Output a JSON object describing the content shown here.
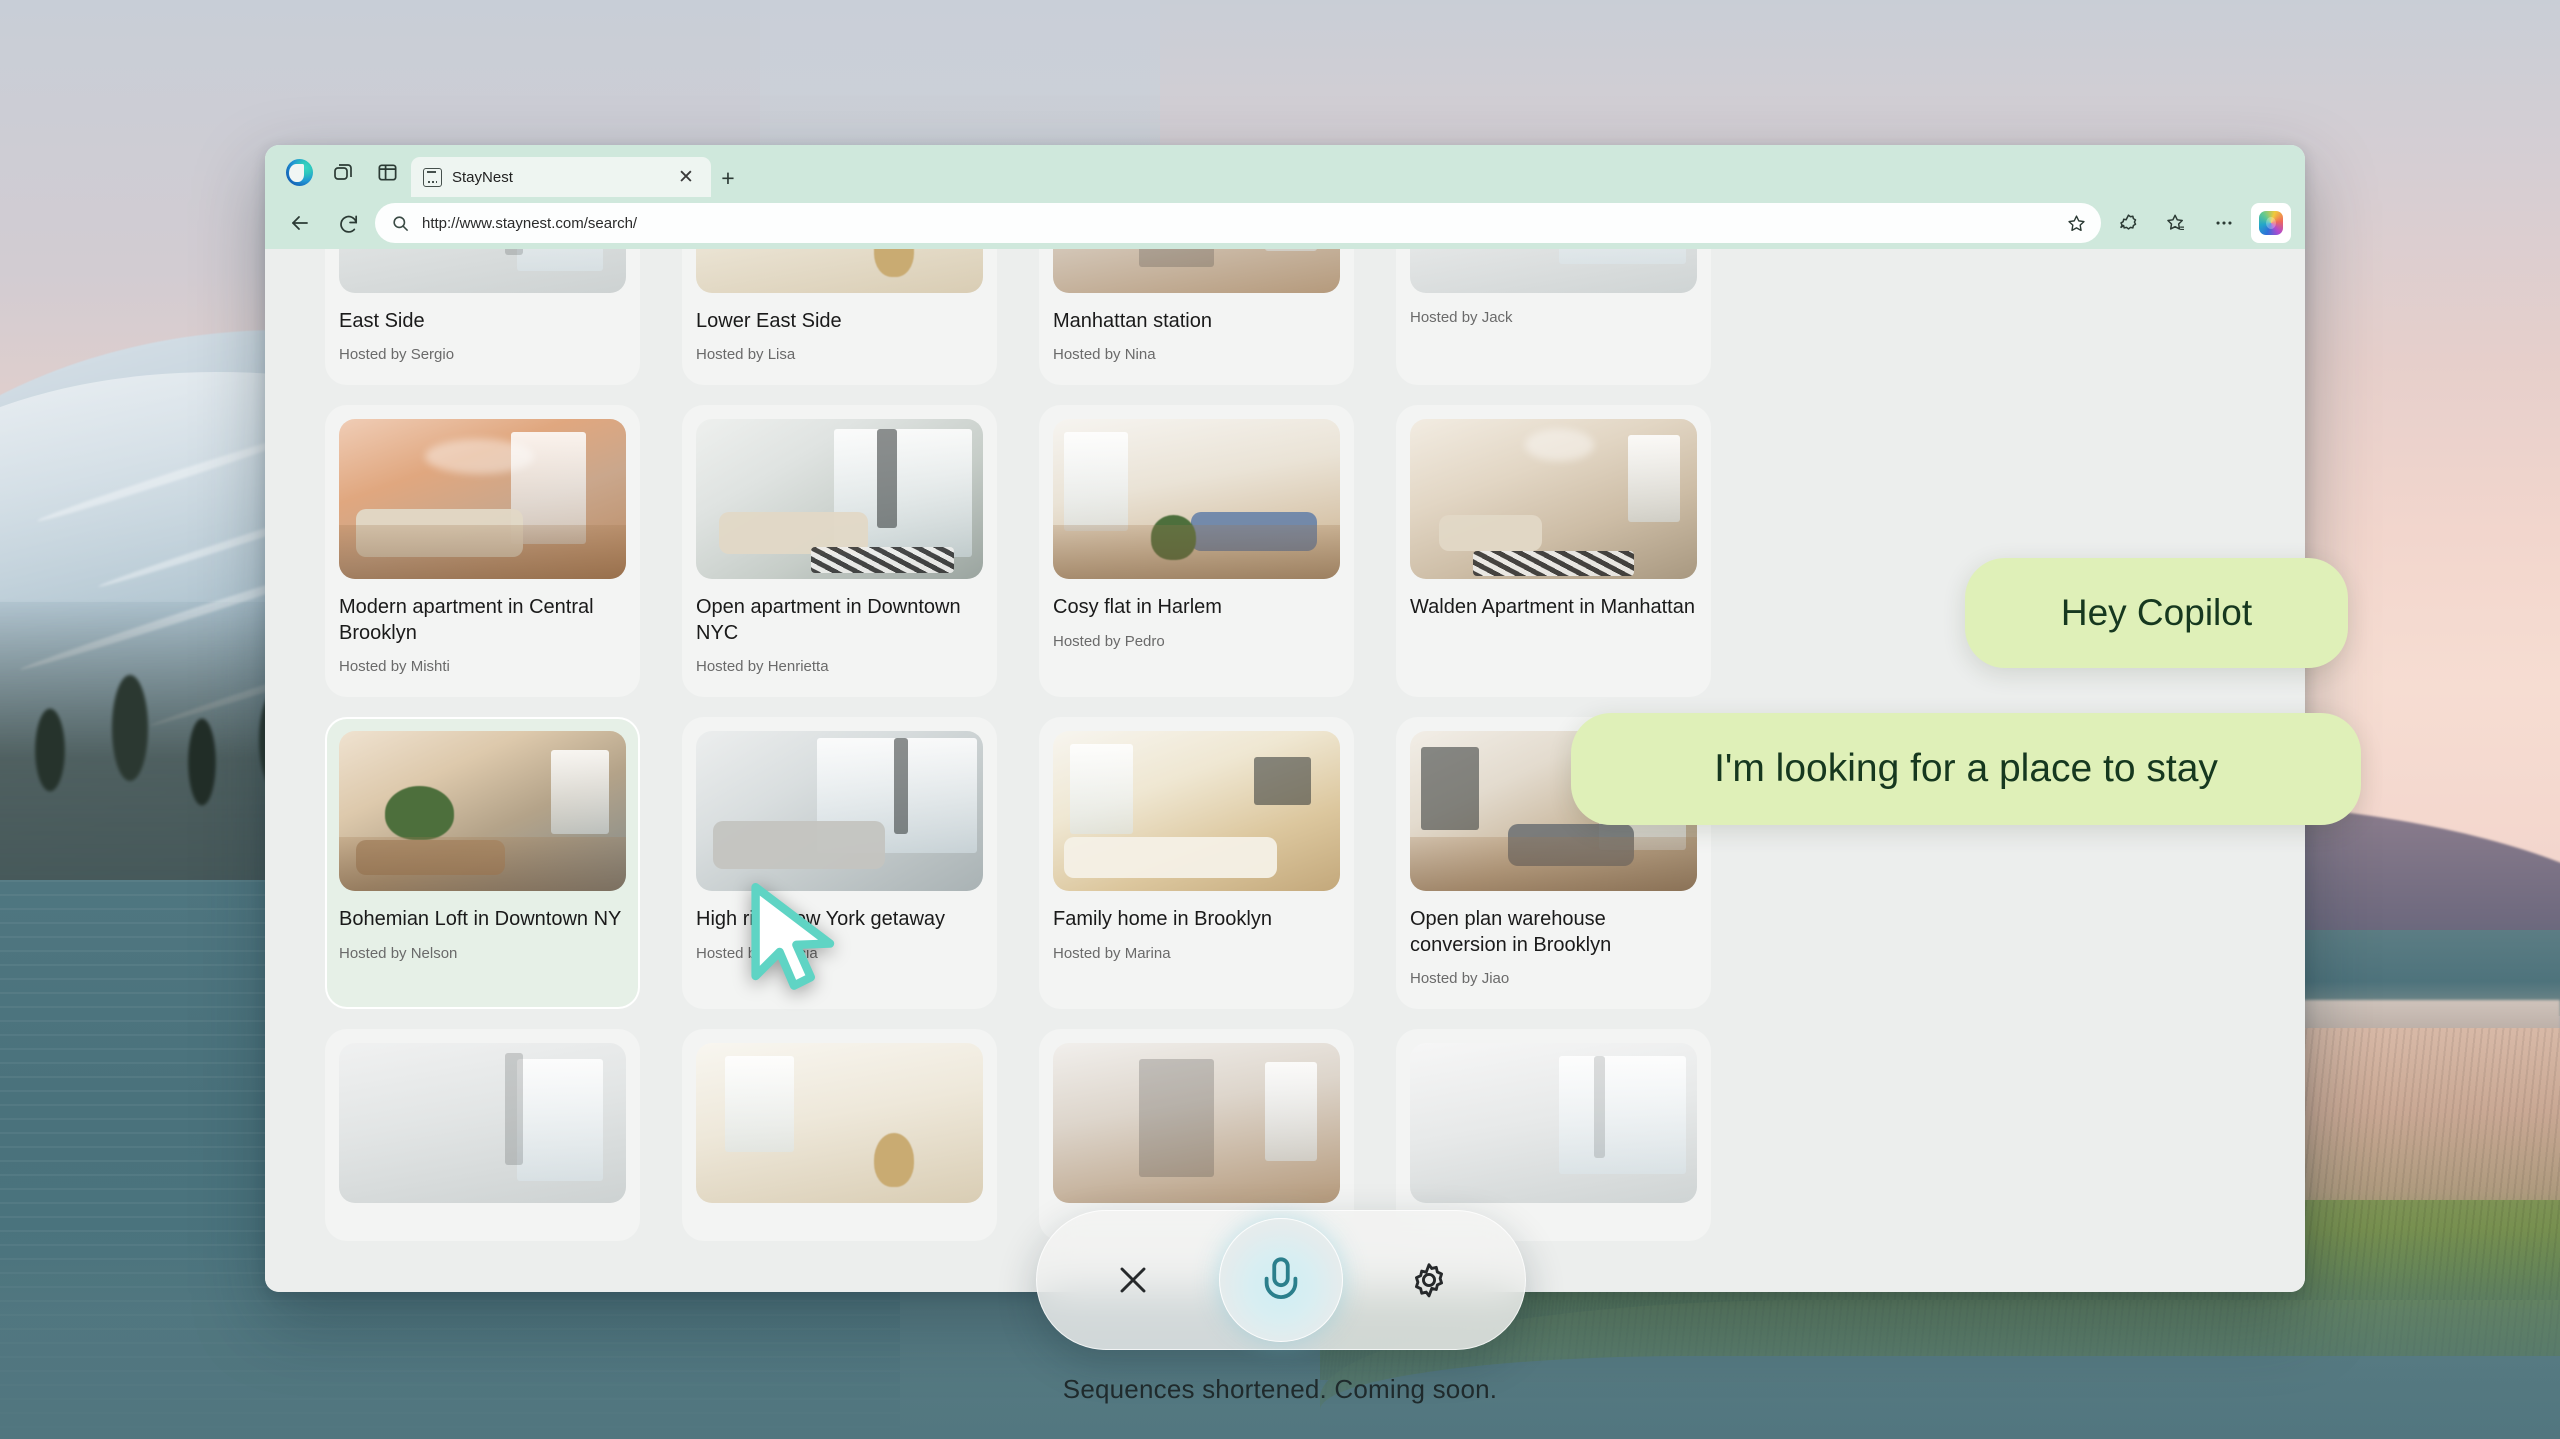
{
  "browser": {
    "app_icon": "edge-logo-icon",
    "workspaces_icon": "workspaces-icon",
    "split_screen_icon": "split-screen-icon",
    "tab": {
      "favicon": "page-favicon-icon",
      "title": "StayNest",
      "close_icon": "close-icon"
    },
    "new_tab_label": "+",
    "back_icon": "back-arrow-icon",
    "refresh_icon": "refresh-icon",
    "search_icon": "search-icon",
    "url": "http://www.staynest.com/search/",
    "favorite_icon": "star-icon",
    "browser_essentials_icon": "browser-essentials-icon",
    "collections_icon": "collections-icon",
    "more_icon": "more-options-icon",
    "copilot_icon": "copilot-icon"
  },
  "page": {
    "host_prefix": "Hosted by",
    "listings": [
      {
        "title": "East Side",
        "title_clipped": true,
        "host": "Hosted by Sergio",
        "photo": "r-plain",
        "selected": false
      },
      {
        "title": "Lower East Side",
        "title_clipped": true,
        "host": "Hosted by Lisa",
        "photo": "r-vase",
        "selected": false
      },
      {
        "title": "Manhattan station",
        "title_clipped": true,
        "host": "Hosted by Nina",
        "photo": "r-hall",
        "selected": false
      },
      {
        "title": "",
        "title_clipped": true,
        "host": "Hosted by Jack",
        "photo": "r-white",
        "selected": false
      },
      {
        "title": "Modern apartment in Central Brooklyn",
        "title_clipped": false,
        "host": "Hosted by Mishti",
        "photo": "r-terracotta",
        "selected": false
      },
      {
        "title": "Open apartment in Downtown NYC",
        "title_clipped": false,
        "host": "Hosted by Henrietta",
        "photo": "r-glass",
        "selected": false
      },
      {
        "title": "Cosy flat in Harlem",
        "title_clipped": false,
        "host": "Hosted by Pedro",
        "photo": "r-light",
        "selected": false
      },
      {
        "title": "Walden Apartment in Manhattan",
        "title_clipped": false,
        "host": "",
        "photo": "r-dining",
        "selected": false
      },
      {
        "title": "Bohemian Loft in Downtown NY",
        "title_clipped": false,
        "host": "Hosted by Nelson",
        "photo": "r-boho",
        "selected": true
      },
      {
        "title": "High rise New York getaway",
        "title_clipped": false,
        "host": "Hosted by Patricia",
        "photo": "r-highrise",
        "selected": false
      },
      {
        "title": "Family home in Brooklyn",
        "title_clipped": false,
        "host": "Hosted by Marina",
        "photo": "r-kitchen",
        "selected": false
      },
      {
        "title": "Open plan warehouse conversion in Brooklyn",
        "title_clipped": false,
        "host": "Hosted by Jiao",
        "photo": "r-warehouse",
        "selected": false
      },
      {
        "title": "",
        "title_clipped": true,
        "host": "",
        "photo": "r-plain",
        "selected": false
      },
      {
        "title": "",
        "title_clipped": true,
        "host": "",
        "photo": "r-vase",
        "selected": false
      },
      {
        "title": "",
        "title_clipped": true,
        "host": "",
        "photo": "r-hall",
        "selected": false
      },
      {
        "title": "",
        "title_clipped": true,
        "host": "",
        "photo": "r-white",
        "selected": false
      }
    ]
  },
  "assistant": {
    "bubbles": [
      {
        "text": "Hey Copilot"
      },
      {
        "text": "I'm looking for a place to stay"
      }
    ],
    "bubble_color": "#dff0b8",
    "bubble_text_color": "#16381f"
  },
  "voice_bar": {
    "close_icon": "close-icon",
    "mic_icon": "microphone-icon",
    "settings_icon": "gear-icon",
    "mic_accent_color": "#2b7f8c"
  },
  "caption": {
    "text": "Sequences shortened. Coming soon."
  },
  "cursor": {
    "icon": "mouse-pointer-icon",
    "fill_color": "#ffffff",
    "outline_color": "#5fd4c4"
  }
}
